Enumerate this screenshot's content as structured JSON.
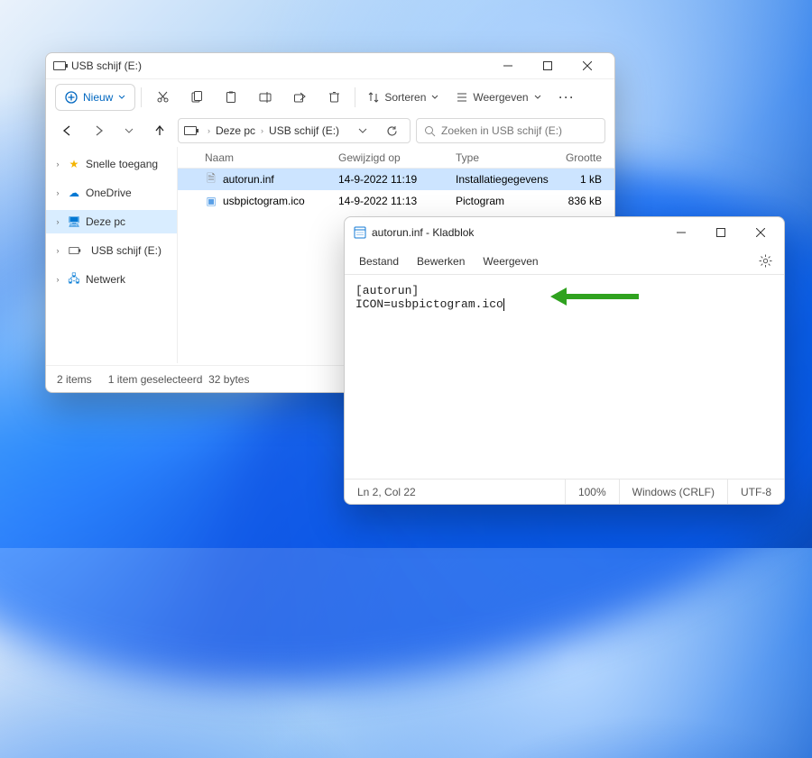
{
  "explorer": {
    "title": "USB schijf (E:)",
    "new_label": "Nieuw",
    "sort_label": "Sorteren",
    "view_label": "Weergeven",
    "breadcrumb": {
      "root": "Deze pc",
      "current": "USB schijf (E:)"
    },
    "search_placeholder": "Zoeken in USB schijf (E:)",
    "sidebar": {
      "items": [
        {
          "label": "Snelle toegang"
        },
        {
          "label": "OneDrive"
        },
        {
          "label": "Deze pc"
        },
        {
          "label": "USB schijf (E:)"
        },
        {
          "label": "Netwerk"
        }
      ]
    },
    "columns": {
      "name": "Naam",
      "date": "Gewijzigd op",
      "type": "Type",
      "size": "Grootte"
    },
    "rows": [
      {
        "name": "autorun.inf",
        "date": "14-9-2022 11:19",
        "type": "Installatiegegevens",
        "size": "1 kB",
        "selected": true
      },
      {
        "name": "usbpictogram.ico",
        "date": "14-9-2022 11:13",
        "type": "Pictogram",
        "size": "836 kB",
        "selected": false
      }
    ],
    "status": {
      "count": "2 items",
      "selection": "1 item geselecteerd",
      "bytes": "32 bytes"
    }
  },
  "notepad": {
    "title": "autorun.inf - Kladblok",
    "menu": {
      "file": "Bestand",
      "edit": "Bewerken",
      "view": "Weergeven"
    },
    "content": "[autorun]\nICON=usbpictogram.ico",
    "status": {
      "pos": "Ln 2, Col 22",
      "zoom": "100%",
      "eol": "Windows (CRLF)",
      "enc": "UTF-8"
    }
  }
}
